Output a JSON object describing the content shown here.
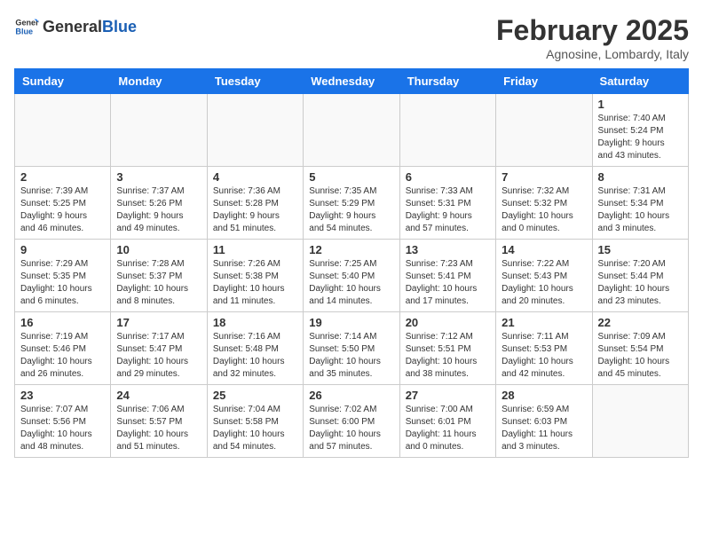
{
  "header": {
    "logo_general": "General",
    "logo_blue": "Blue",
    "month_year": "February 2025",
    "location": "Agnosine, Lombardy, Italy"
  },
  "weekdays": [
    "Sunday",
    "Monday",
    "Tuesday",
    "Wednesday",
    "Thursday",
    "Friday",
    "Saturday"
  ],
  "weeks": [
    [
      {
        "day": "",
        "info": ""
      },
      {
        "day": "",
        "info": ""
      },
      {
        "day": "",
        "info": ""
      },
      {
        "day": "",
        "info": ""
      },
      {
        "day": "",
        "info": ""
      },
      {
        "day": "",
        "info": ""
      },
      {
        "day": "1",
        "info": "Sunrise: 7:40 AM\nSunset: 5:24 PM\nDaylight: 9 hours\nand 43 minutes."
      }
    ],
    [
      {
        "day": "2",
        "info": "Sunrise: 7:39 AM\nSunset: 5:25 PM\nDaylight: 9 hours\nand 46 minutes."
      },
      {
        "day": "3",
        "info": "Sunrise: 7:37 AM\nSunset: 5:26 PM\nDaylight: 9 hours\nand 49 minutes."
      },
      {
        "day": "4",
        "info": "Sunrise: 7:36 AM\nSunset: 5:28 PM\nDaylight: 9 hours\nand 51 minutes."
      },
      {
        "day": "5",
        "info": "Sunrise: 7:35 AM\nSunset: 5:29 PM\nDaylight: 9 hours\nand 54 minutes."
      },
      {
        "day": "6",
        "info": "Sunrise: 7:33 AM\nSunset: 5:31 PM\nDaylight: 9 hours\nand 57 minutes."
      },
      {
        "day": "7",
        "info": "Sunrise: 7:32 AM\nSunset: 5:32 PM\nDaylight: 10 hours\nand 0 minutes."
      },
      {
        "day": "8",
        "info": "Sunrise: 7:31 AM\nSunset: 5:34 PM\nDaylight: 10 hours\nand 3 minutes."
      }
    ],
    [
      {
        "day": "9",
        "info": "Sunrise: 7:29 AM\nSunset: 5:35 PM\nDaylight: 10 hours\nand 6 minutes."
      },
      {
        "day": "10",
        "info": "Sunrise: 7:28 AM\nSunset: 5:37 PM\nDaylight: 10 hours\nand 8 minutes."
      },
      {
        "day": "11",
        "info": "Sunrise: 7:26 AM\nSunset: 5:38 PM\nDaylight: 10 hours\nand 11 minutes."
      },
      {
        "day": "12",
        "info": "Sunrise: 7:25 AM\nSunset: 5:40 PM\nDaylight: 10 hours\nand 14 minutes."
      },
      {
        "day": "13",
        "info": "Sunrise: 7:23 AM\nSunset: 5:41 PM\nDaylight: 10 hours\nand 17 minutes."
      },
      {
        "day": "14",
        "info": "Sunrise: 7:22 AM\nSunset: 5:43 PM\nDaylight: 10 hours\nand 20 minutes."
      },
      {
        "day": "15",
        "info": "Sunrise: 7:20 AM\nSunset: 5:44 PM\nDaylight: 10 hours\nand 23 minutes."
      }
    ],
    [
      {
        "day": "16",
        "info": "Sunrise: 7:19 AM\nSunset: 5:46 PM\nDaylight: 10 hours\nand 26 minutes."
      },
      {
        "day": "17",
        "info": "Sunrise: 7:17 AM\nSunset: 5:47 PM\nDaylight: 10 hours\nand 29 minutes."
      },
      {
        "day": "18",
        "info": "Sunrise: 7:16 AM\nSunset: 5:48 PM\nDaylight: 10 hours\nand 32 minutes."
      },
      {
        "day": "19",
        "info": "Sunrise: 7:14 AM\nSunset: 5:50 PM\nDaylight: 10 hours\nand 35 minutes."
      },
      {
        "day": "20",
        "info": "Sunrise: 7:12 AM\nSunset: 5:51 PM\nDaylight: 10 hours\nand 38 minutes."
      },
      {
        "day": "21",
        "info": "Sunrise: 7:11 AM\nSunset: 5:53 PM\nDaylight: 10 hours\nand 42 minutes."
      },
      {
        "day": "22",
        "info": "Sunrise: 7:09 AM\nSunset: 5:54 PM\nDaylight: 10 hours\nand 45 minutes."
      }
    ],
    [
      {
        "day": "23",
        "info": "Sunrise: 7:07 AM\nSunset: 5:56 PM\nDaylight: 10 hours\nand 48 minutes."
      },
      {
        "day": "24",
        "info": "Sunrise: 7:06 AM\nSunset: 5:57 PM\nDaylight: 10 hours\nand 51 minutes."
      },
      {
        "day": "25",
        "info": "Sunrise: 7:04 AM\nSunset: 5:58 PM\nDaylight: 10 hours\nand 54 minutes."
      },
      {
        "day": "26",
        "info": "Sunrise: 7:02 AM\nSunset: 6:00 PM\nDaylight: 10 hours\nand 57 minutes."
      },
      {
        "day": "27",
        "info": "Sunrise: 7:00 AM\nSunset: 6:01 PM\nDaylight: 11 hours\nand 0 minutes."
      },
      {
        "day": "28",
        "info": "Sunrise: 6:59 AM\nSunset: 6:03 PM\nDaylight: 11 hours\nand 3 minutes."
      },
      {
        "day": "",
        "info": ""
      }
    ]
  ]
}
